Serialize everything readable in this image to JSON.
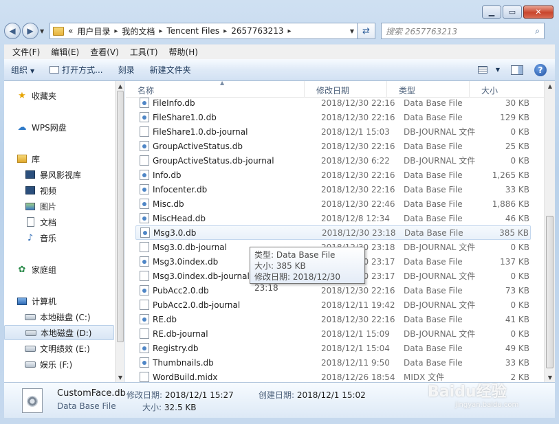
{
  "window": {
    "min_glyph": "▁",
    "max_glyph": "▭",
    "close_glyph": "✕"
  },
  "address": {
    "lead": "«",
    "crumbs": [
      "用户目录",
      "我的文档",
      "Tencent Files",
      "2657763213"
    ],
    "sep": "▸"
  },
  "search": {
    "placeholder": "搜索 2657763213"
  },
  "menu": [
    "文件(F)",
    "编辑(E)",
    "查看(V)",
    "工具(T)",
    "帮助(H)"
  ],
  "toolbar": {
    "organize": "组织",
    "open_with": "打开方式...",
    "burn": "刻录",
    "new_folder": "新建文件夹"
  },
  "nav": {
    "favorites": "收藏夹",
    "wps": "WPS网盘",
    "library": "库",
    "lib_items": [
      "暴风影视库",
      "视频",
      "图片",
      "文档",
      "音乐"
    ],
    "homegroup": "家庭组",
    "computer": "计算机",
    "drives": [
      "本地磁盘 (C:)",
      "本地磁盘 (D:)",
      "文明绩效 (E:)",
      "娱乐 (F:)"
    ]
  },
  "columns": {
    "name": "名称",
    "date": "修改日期",
    "type": "类型",
    "size": "大小"
  },
  "files": [
    {
      "name": "FileInfo.db",
      "date": "2018/12/30 22:16",
      "type": "Data Base File",
      "size": "30 KB",
      "kind": "db"
    },
    {
      "name": "FileShare1.0.db",
      "date": "2018/12/30 22:16",
      "type": "Data Base File",
      "size": "129 KB",
      "kind": "db"
    },
    {
      "name": "FileShare1.0.db-journal",
      "date": "2018/12/1 15:03",
      "type": "DB-JOURNAL 文件",
      "size": "0 KB",
      "kind": "blank"
    },
    {
      "name": "GroupActiveStatus.db",
      "date": "2018/12/30 22:16",
      "type": "Data Base File",
      "size": "25 KB",
      "kind": "db"
    },
    {
      "name": "GroupActiveStatus.db-journal",
      "date": "2018/12/30 6:22",
      "type": "DB-JOURNAL 文件",
      "size": "0 KB",
      "kind": "blank"
    },
    {
      "name": "Info.db",
      "date": "2018/12/30 22:16",
      "type": "Data Base File",
      "size": "1,265 KB",
      "kind": "db"
    },
    {
      "name": "Infocenter.db",
      "date": "2018/12/30 22:16",
      "type": "Data Base File",
      "size": "33 KB",
      "kind": "db"
    },
    {
      "name": "Misc.db",
      "date": "2018/12/30 22:46",
      "type": "Data Base File",
      "size": "1,886 KB",
      "kind": "db"
    },
    {
      "name": "MiscHead.db",
      "date": "2018/12/8 12:34",
      "type": "Data Base File",
      "size": "46 KB",
      "kind": "db"
    },
    {
      "name": "Msg3.0.db",
      "date": "2018/12/30 23:18",
      "type": "Data Base File",
      "size": "385 KB",
      "kind": "db"
    },
    {
      "name": "Msg3.0.db-journal",
      "date": "2018/12/30 23:18",
      "type": "DB-JOURNAL 文件",
      "size": "0 KB",
      "kind": "blank"
    },
    {
      "name": "Msg3.0index.db",
      "date": "2018/12/30 23:17",
      "type": "Data Base File",
      "size": "137 KB",
      "kind": "db"
    },
    {
      "name": "Msg3.0index.db-journal",
      "date": "2018/12/30 23:17",
      "type": "DB-JOURNAL 文件",
      "size": "0 KB",
      "kind": "blank"
    },
    {
      "name": "PubAcc2.0.db",
      "date": "2018/12/30 22:16",
      "type": "Data Base File",
      "size": "73 KB",
      "kind": "db"
    },
    {
      "name": "PubAcc2.0.db-journal",
      "date": "2018/12/11 19:42",
      "type": "DB-JOURNAL 文件",
      "size": "0 KB",
      "kind": "blank"
    },
    {
      "name": "RE.db",
      "date": "2018/12/30 22:16",
      "type": "Data Base File",
      "size": "41 KB",
      "kind": "db"
    },
    {
      "name": "RE.db-journal",
      "date": "2018/12/1 15:09",
      "type": "DB-JOURNAL 文件",
      "size": "0 KB",
      "kind": "blank"
    },
    {
      "name": "Registry.db",
      "date": "2018/12/1 15:04",
      "type": "Data Base File",
      "size": "49 KB",
      "kind": "db"
    },
    {
      "name": "Thumbnails.db",
      "date": "2018/12/11 9:50",
      "type": "Data Base File",
      "size": "33 KB",
      "kind": "db"
    },
    {
      "name": "WordBuild.midx",
      "date": "2018/12/26 18:54",
      "type": "MIDX 文件",
      "size": "2 KB",
      "kind": "blank"
    }
  ],
  "tooltip": {
    "line1": "类型: Data Base File",
    "line2": "大小: 385 KB",
    "line3": "修改日期: 2018/12/30 23:18"
  },
  "details": {
    "name": "CustomFace.db",
    "type": "Data Base File",
    "modified_label": "修改日期:",
    "modified": "2018/12/1 15:27",
    "created_label": "创建日期:",
    "created": "2018/12/1 15:02",
    "size_label": "大小:",
    "size": "32.5 KB"
  },
  "watermark": {
    "main": "Baidu经验",
    "sub": "jingyan.baidu.com"
  },
  "colors": {
    "accent": "#2f6bb5",
    "hover_border": "#c3d7ee",
    "close_red": "#c9452c"
  }
}
